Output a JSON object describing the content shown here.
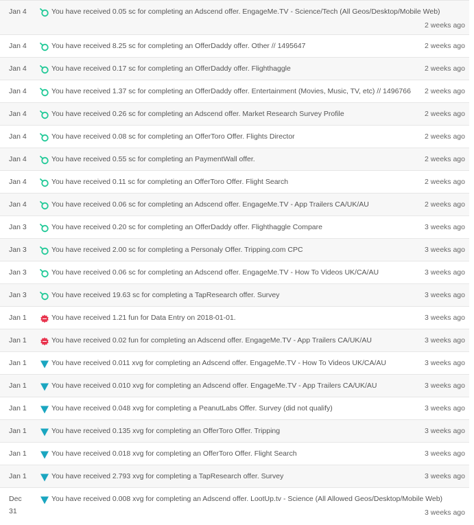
{
  "icons": {
    "sc": {
      "name": "siacoin-icon",
      "color": "#20c997"
    },
    "fun": {
      "name": "funfair-icon",
      "color": "#e8344e"
    },
    "xvg": {
      "name": "verge-icon",
      "color": "#1aa6c0"
    }
  },
  "transactions": [
    {
      "date": "Jan 4",
      "currency": "sc",
      "message": "You have received 0.05 sc for completing an Adscend offer. EngageMe.TV - Science/Tech (All Geos/Desktop/Mobile Web)",
      "time": "2 weeks ago"
    },
    {
      "date": "Jan 4",
      "currency": "sc",
      "message": "You have received 8.25 sc for completing an OfferDaddy offer. Other // 1495647",
      "time": "2 weeks ago"
    },
    {
      "date": "Jan 4",
      "currency": "sc",
      "message": "You have received 0.17 sc for completing an OfferDaddy offer. Flighthaggle",
      "time": "2 weeks ago"
    },
    {
      "date": "Jan 4",
      "currency": "sc",
      "message": "You have received 1.37 sc for completing an OfferDaddy offer. Entertainment (Movies, Music, TV, etc) // 1496766",
      "time": "2 weeks ago"
    },
    {
      "date": "Jan 4",
      "currency": "sc",
      "message": "You have received 0.26 sc for completing an Adscend offer. Market Research Survey Profile",
      "time": "2 weeks ago"
    },
    {
      "date": "Jan 4",
      "currency": "sc",
      "message": "You have received 0.08 sc for completing an OfferToro Offer. Flights Director",
      "time": "2 weeks ago"
    },
    {
      "date": "Jan 4",
      "currency": "sc",
      "message": "You have received 0.55 sc for completing an PaymentWall offer.",
      "time": "2 weeks ago"
    },
    {
      "date": "Jan 4",
      "currency": "sc",
      "message": "You have received 0.11 sc for completing an OfferToro Offer. Flight Search",
      "time": "2 weeks ago"
    },
    {
      "date": "Jan 4",
      "currency": "sc",
      "message": "You have received 0.06 sc for completing an Adscend offer. EngageMe.TV - App Trailers CA/UK/AU",
      "time": "2 weeks ago"
    },
    {
      "date": "Jan 3",
      "currency": "sc",
      "message": "You have received 0.20 sc for completing an OfferDaddy offer. Flighthaggle Compare",
      "time": "3 weeks ago"
    },
    {
      "date": "Jan 3",
      "currency": "sc",
      "message": "You have received 2.00 sc for completing a Personaly Offer. Tripping.com CPC",
      "time": "3 weeks ago"
    },
    {
      "date": "Jan 3",
      "currency": "sc",
      "message": "You have received 0.06 sc for completing an Adscend offer. EngageMe.TV - How To Videos UK/CA/AU",
      "time": "3 weeks ago"
    },
    {
      "date": "Jan 3",
      "currency": "sc",
      "message": "You have received 19.63 sc for completing a TapResearch offer. Survey",
      "time": "3 weeks ago"
    },
    {
      "date": "Jan 1",
      "currency": "fun",
      "message": "You have received 1.21 fun for Data Entry on 2018-01-01.",
      "time": "3 weeks ago"
    },
    {
      "date": "Jan 1",
      "currency": "fun",
      "message": "You have received 0.02 fun for completing an Adscend offer. EngageMe.TV - App Trailers CA/UK/AU",
      "time": "3 weeks ago"
    },
    {
      "date": "Jan 1",
      "currency": "xvg",
      "message": "You have received 0.011 xvg for completing an Adscend offer. EngageMe.TV - How To Videos UK/CA/AU",
      "time": "3 weeks ago"
    },
    {
      "date": "Jan 1",
      "currency": "xvg",
      "message": "You have received 0.010 xvg for completing an Adscend offer. EngageMe.TV - App Trailers CA/UK/AU",
      "time": "3 weeks ago"
    },
    {
      "date": "Jan 1",
      "currency": "xvg",
      "message": "You have received 0.048 xvg for completing a PeanutLabs Offer. Survey (did not qualify)",
      "time": "3 weeks ago"
    },
    {
      "date": "Jan 1",
      "currency": "xvg",
      "message": "You have received 0.135 xvg for completing an OfferToro Offer. Tripping",
      "time": "3 weeks ago"
    },
    {
      "date": "Jan 1",
      "currency": "xvg",
      "message": "You have received 0.018 xvg for completing an OfferToro Offer. Flight Search",
      "time": "3 weeks ago"
    },
    {
      "date": "Jan 1",
      "currency": "xvg",
      "message": "You have received 2.793 xvg for completing a TapResearch offer. Survey",
      "time": "3 weeks ago"
    },
    {
      "date": "Dec 31",
      "currency": "xvg",
      "message": "You have received 0.008 xvg for completing an Adscend offer. LootUp.tv - Science (All Allowed Geos/Desktop/Mobile Web)",
      "time": "3 weeks ago"
    }
  ]
}
